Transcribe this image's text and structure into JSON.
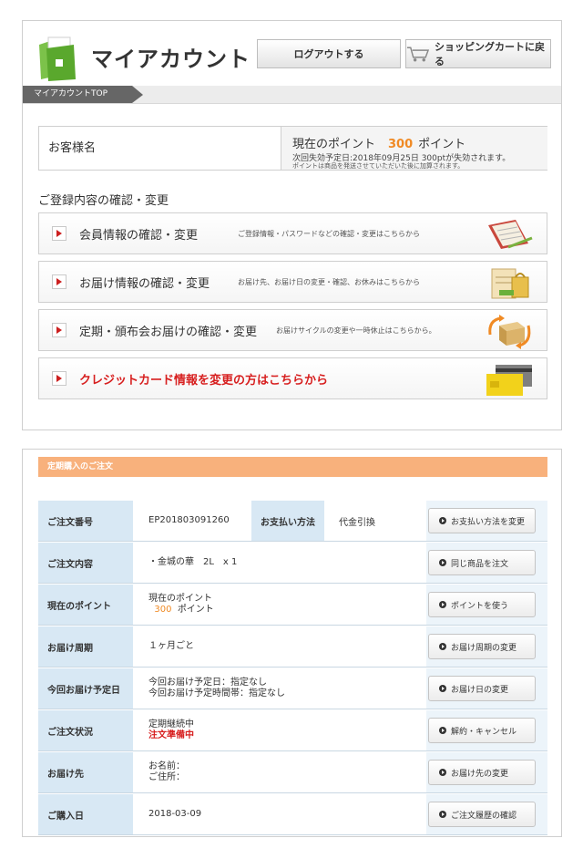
{
  "header": {
    "title": "マイアカウント",
    "logout_label": "ログアウトする",
    "cart_label": "ショッピングカートに戻る"
  },
  "breadcrumb": {
    "current": "マイアカウントTOP"
  },
  "customer": {
    "name_label": "お客様名",
    "points_prefix": "現在のポイント",
    "points_value": "300",
    "points_suffix": "ポイント",
    "expiry_note": "次回失効予定日:2018年09月25日 300ptが失効されます。",
    "points_note": "ポイントは商品を発送させていただいた後に加算されます。"
  },
  "section_title": "ご登録内容の確認・変更",
  "menu": [
    {
      "label": "会員情報の確認・変更",
      "desc": "ご登録情報・パスワードなどの確認・変更はこちらから",
      "icon": "notebook-icon"
    },
    {
      "label": "お届け情報の確認・変更",
      "desc": "お届け先、お届け日の変更・確認、お休みはこちらから",
      "icon": "clipboard-bag-icon"
    },
    {
      "label": "定期・頒布会お届けの確認・変更",
      "desc": "お届けサイクルの変更や一時休止はこちらから。",
      "icon": "box-cycle-icon"
    },
    {
      "label": "クレジットカード情報を変更の方はこちらから",
      "desc": "",
      "icon": "credit-card-icon"
    }
  ],
  "order": {
    "header": "定期購入のご注文",
    "rows": [
      {
        "label": "ご注文番号",
        "value1": "EP201803091260",
        "mid_label": "お支払い方法",
        "mid_value": "代金引換",
        "button": "お支払い方法を変更"
      },
      {
        "label": "ご注文内容",
        "value1": "・金城の華　2L　x 1",
        "button": "同じ商品を注文"
      },
      {
        "label": "現在のポイント",
        "value1": "現在のポイント",
        "value2_num": "300",
        "value2_suffix": "ポイント",
        "button": "ポイントを使う"
      },
      {
        "label": "お届け周期",
        "value1": "１ヶ月ごと",
        "button": "お届け周期の変更"
      },
      {
        "label": "今回お届け予定日",
        "value1": "今回お届け予定日：指定なし",
        "value2": "今回お届け予定時間帯：指定なし",
        "button": "お届け日の変更"
      },
      {
        "label": "ご注文状況",
        "value1": "定期継続中",
        "value2": "注文準備中",
        "button": "解約・キャンセル"
      },
      {
        "label": "お届け先",
        "value1": "お名前：",
        "value2": "ご住所：",
        "button": "お届け先の変更"
      },
      {
        "label": "ご購入日",
        "value1": "2018-03-09",
        "button": "ご注文履歴の確認"
      }
    ]
  },
  "colors": {
    "accent_orange": "#f08a24",
    "alert_red": "#d71f1f",
    "order_header_bg": "#f8b17c",
    "table_label_bg": "#d8e8f4"
  }
}
